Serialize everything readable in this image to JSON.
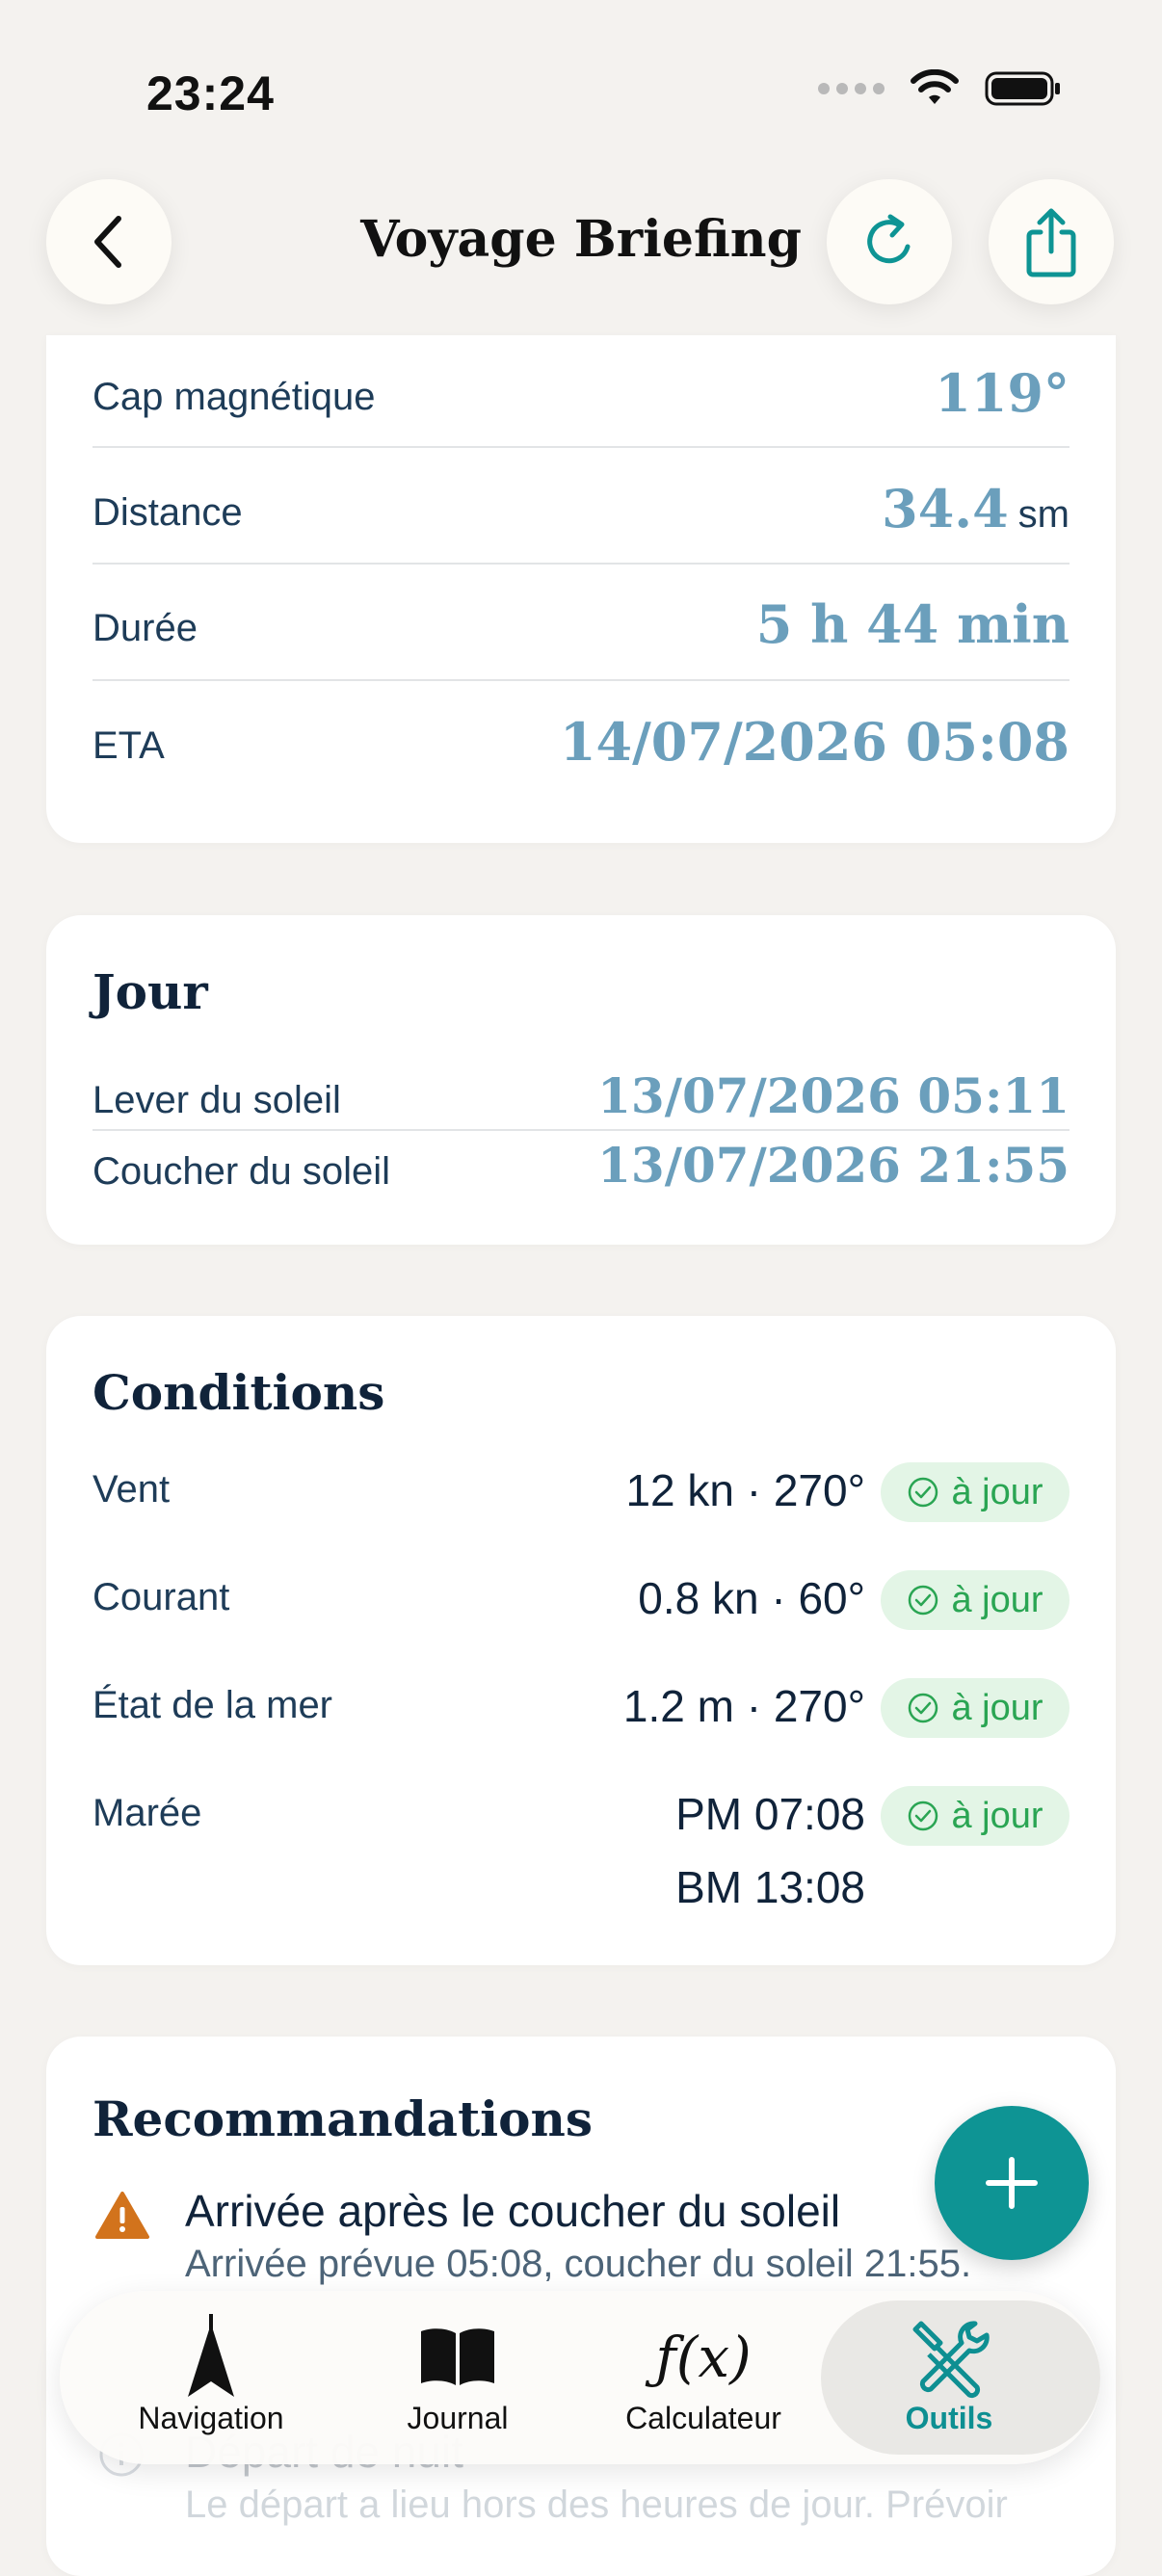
{
  "status_bar": {
    "time": "23:24"
  },
  "header": {
    "title": "Voyage Briefing"
  },
  "route": {
    "rows": [
      {
        "label": "Cap magnétique",
        "value": "119°",
        "unit": ""
      },
      {
        "label": "Distance",
        "value": "34.4",
        "unit": "sm"
      },
      {
        "label": "Durée",
        "value": "5 h 44 min",
        "unit": ""
      },
      {
        "label": "ETA",
        "value": "14/07/2026 05:08",
        "unit": ""
      }
    ]
  },
  "day": {
    "title": "Jour",
    "rows": [
      {
        "label": "Lever du soleil",
        "value": "13/07/2026 05:11"
      },
      {
        "label": "Coucher du soleil",
        "value": "13/07/2026 21:55"
      }
    ]
  },
  "conditions": {
    "title": "Conditions",
    "rows": [
      {
        "label": "Vent",
        "value": "12 kn · 270°",
        "badge": "à jour"
      },
      {
        "label": "Courant",
        "value": "0.8 kn · 60°",
        "badge": "à jour"
      },
      {
        "label": "État de la mer",
        "value": "1.2 m · 270°",
        "badge": "à jour"
      },
      {
        "label": "Marée",
        "value": "PM 07:08",
        "value2": "BM 13:08",
        "badge": "à jour"
      }
    ]
  },
  "recommendations": {
    "title": "Recommandations",
    "items": [
      {
        "title": "Arrivée après le coucher du soleil",
        "text": "Arrivée prévue 05:08, coucher du soleil 21:55."
      },
      {
        "title": "Départ de nuit",
        "text": "Le départ a lieu hors des heures de jour. Prévoir"
      }
    ]
  },
  "tabbar": {
    "tabs": [
      {
        "label": "Navigation",
        "icon": "navigation-arrow-icon"
      },
      {
        "label": "Journal",
        "icon": "book-icon"
      },
      {
        "label": "Calculateur",
        "icon": "function-icon",
        "glyph": "ƒ(x)"
      },
      {
        "label": "Outils",
        "icon": "tools-icon",
        "active": true
      }
    ]
  },
  "colors": {
    "accent": "#0e9494",
    "value_blue": "#6b9fbc",
    "badge_green": "#2aa553",
    "warning": "#d2731c"
  }
}
